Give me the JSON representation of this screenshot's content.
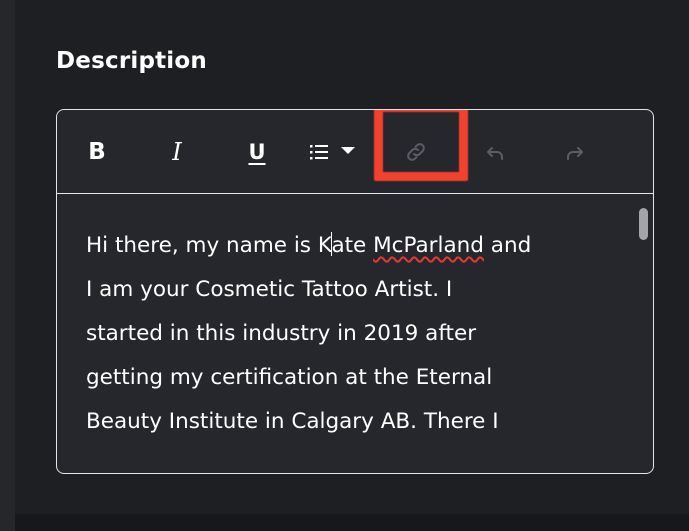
{
  "section": {
    "title": "Description"
  },
  "toolbar": {
    "bold_label": "B",
    "italic_label": "I",
    "underline_label": "U",
    "buttons": {
      "list_icon": "bulleted-list-icon",
      "link_icon": "link-icon",
      "undo_icon": "undo-icon",
      "redo_icon": "redo-icon"
    }
  },
  "editor": {
    "lines": [
      {
        "pre": "Hi  there, my name is K",
        "post": "ate ",
        "spell": "McParland",
        "tail": " and"
      },
      "I am your Cosmetic Tattoo Artist. I",
      "started in this industry in 2019 after",
      "getting my certification at the  Eternal",
      "Beauty Institute in Calgary AB. There I"
    ]
  },
  "colors": {
    "background": "#1e1f23",
    "editor_bg": "#26272c",
    "border": "#e4e4e7",
    "highlight": "#f2412f",
    "disabled_icon": "#5c5d63"
  }
}
